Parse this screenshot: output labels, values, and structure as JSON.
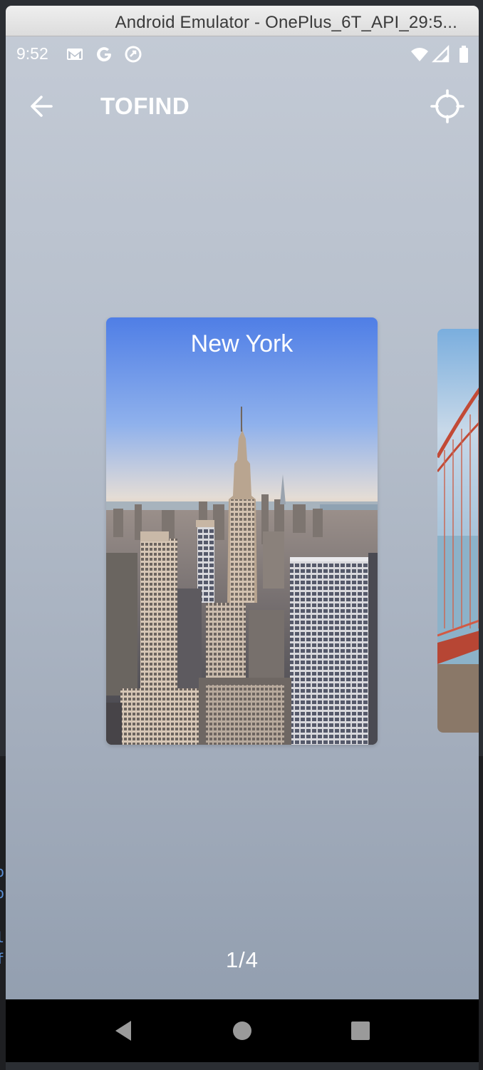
{
  "window": {
    "title": "Android Emulator - OnePlus_6T_API_29:5..."
  },
  "status_bar": {
    "time": "9:52",
    "left_icons": [
      "gmail-icon",
      "google-icon",
      "data-saver-icon"
    ],
    "right_icons": [
      "wifi-icon",
      "signal-icon",
      "battery-icon"
    ]
  },
  "app_bar": {
    "title": "TOFIND",
    "back_icon": "arrow-back-icon",
    "action_icon": "my-location-icon"
  },
  "carousel": {
    "cards": [
      {
        "title": "New York"
      }
    ],
    "page_indicator": "1/4"
  },
  "nav_bar": {
    "buttons": [
      "back-triangle-icon",
      "home-circle-icon",
      "recents-square-icon"
    ]
  },
  "colors": {
    "sky_top": "#4f7ee6",
    "sky_bottom": "#f2c48c",
    "screen_top": "#c3cad5",
    "screen_bottom": "#939fb0"
  }
}
